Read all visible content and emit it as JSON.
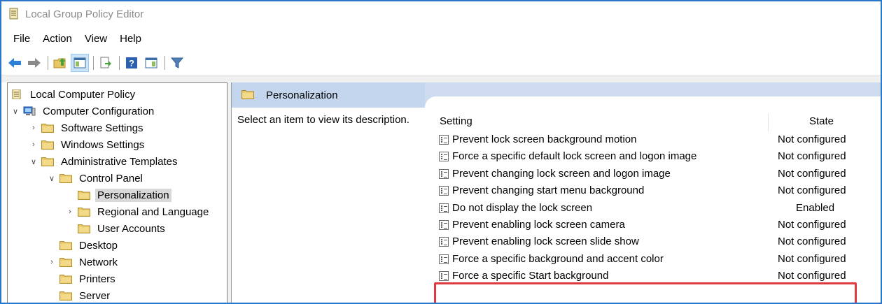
{
  "window": {
    "title": "Local Group Policy Editor"
  },
  "menu": [
    "File",
    "Action",
    "View",
    "Help"
  ],
  "toolbar": {
    "buttons": [
      "back-icon",
      "forward-icon",
      "up-folder-icon",
      "show-hide-tree-icon",
      "properties-icon",
      "export-list-icon",
      "help-icon",
      "show-hide-action-pane-icon",
      "filter-icon"
    ],
    "active": "show-hide-tree-icon"
  },
  "tree": {
    "root": "Local Computer Policy",
    "computer_configuration": "Computer Configuration",
    "software_settings": "Software Settings",
    "windows_settings": "Windows Settings",
    "administrative_templates": "Administrative Templates",
    "control_panel": "Control Panel",
    "personalization": "Personalization",
    "regional_and_language": "Regional and Language",
    "user_accounts": "User Accounts",
    "desktop": "Desktop",
    "network": "Network",
    "printers": "Printers",
    "server": "Server"
  },
  "right": {
    "header": "Personalization",
    "description": "Select an item to view its description.",
    "columns": {
      "setting": "Setting",
      "state": "State"
    },
    "rows": [
      {
        "setting": "Prevent lock screen background motion",
        "state": "Not configured"
      },
      {
        "setting": "Force a specific default lock screen and logon image",
        "state": "Not configured"
      },
      {
        "setting": "Prevent changing lock screen and logon image",
        "state": "Not configured"
      },
      {
        "setting": "Prevent changing start menu background",
        "state": "Not configured"
      },
      {
        "setting": "Do not display the lock screen",
        "state": "Enabled"
      },
      {
        "setting": "Prevent enabling lock screen camera",
        "state": "Not configured"
      },
      {
        "setting": "Prevent enabling lock screen slide show",
        "state": "Not configured"
      },
      {
        "setting": "Force a specific background and accent color",
        "state": "Not configured"
      },
      {
        "setting": "Force a specific Start background",
        "state": "Not configured"
      }
    ],
    "highlighted_row": 4
  },
  "colors": {
    "window_border": "#2a77c9",
    "highlight_box": "#e03a3e",
    "pane_header": "#cfdcf0",
    "folder": "#e8c664"
  }
}
